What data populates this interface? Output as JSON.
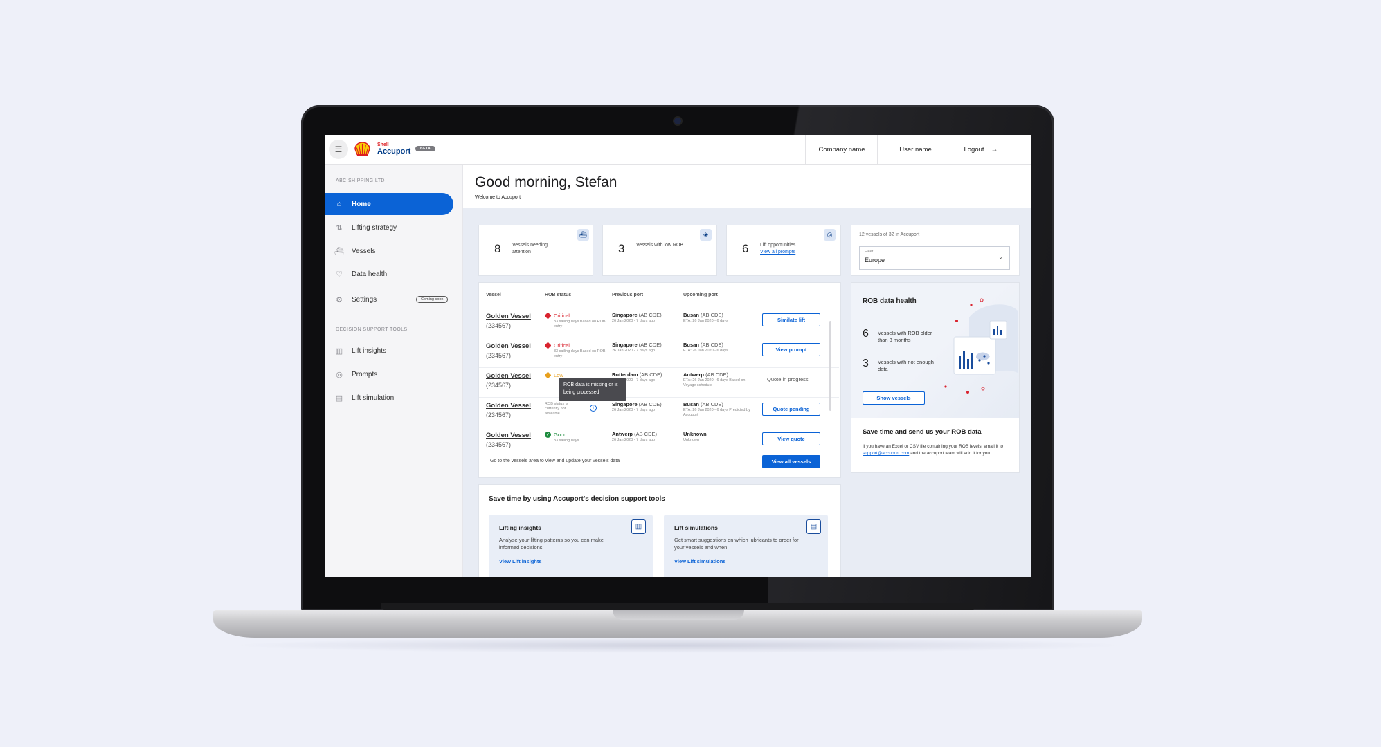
{
  "app": {
    "brand_top": "Shell",
    "brand_main": "Accuport",
    "beta": "BETA"
  },
  "topbar": {
    "company": "Company name",
    "user": "User name",
    "logout": "Logout"
  },
  "sidebar": {
    "org_label": "ABC SHIPPING LTD",
    "items": [
      {
        "label": "Home",
        "icon": "home-icon"
      },
      {
        "label": "Lifting strategy",
        "icon": "strategy-icon"
      },
      {
        "label": "Vessels",
        "icon": "ship-icon"
      },
      {
        "label": "Data health",
        "icon": "heart-icon"
      },
      {
        "label": "Settings",
        "icon": "gear-icon",
        "badge": "Coming soon"
      }
    ],
    "tools_label": "DECISION SUPPORT TOOLS",
    "tools": [
      {
        "label": "Lift insights",
        "icon": "bar-chart-icon"
      },
      {
        "label": "Prompts",
        "icon": "lightbulb-icon"
      },
      {
        "label": "Lift simulation",
        "icon": "simulation-icon"
      }
    ]
  },
  "header": {
    "greeting": "Good morning, Stefan",
    "welcome": "Welcome to Accuport"
  },
  "kpis": [
    {
      "value": "8",
      "label": "Vessels needing attention",
      "icon": "ship-icon"
    },
    {
      "value": "3",
      "label": "Vessels with low ROB",
      "icon": "alert-icon"
    },
    {
      "value": "6",
      "label": "Lift opportunities",
      "link": "View all prompts",
      "icon": "lightbulb-icon"
    }
  ],
  "fleet": {
    "title": "12 vessels of 32 in Accuport",
    "label": "Fleet",
    "value": "Europe"
  },
  "table": {
    "headers": [
      "Vessel",
      "ROB status",
      "Previous port",
      "Upcoming port"
    ],
    "rows": [
      {
        "name": "Golden Vessel",
        "id": "(234567)",
        "status": "Critical",
        "status_sub": "33 sailing days Based on ROB entry",
        "prev": "Singapore",
        "prev_code": "(AB CDE)",
        "prev_sub": "26 Jan 2020 - 7 days ago",
        "next": "Busan",
        "next_code": "(AB CDE)",
        "next_sub": "ETA: 26 Jan 2020 - 6 days",
        "action": "Similate lift"
      },
      {
        "name": "Golden Vessel",
        "id": "(234567)",
        "status": "Critical",
        "status_sub": "33 sailing days Based on ROB entry",
        "prev": "Singapore",
        "prev_code": "(AB CDE)",
        "prev_sub": "26 Jan 2020 - 7 days ago",
        "next": "Busan",
        "next_code": "(AB CDE)",
        "next_sub": "ETA: 26 Jan 2020 - 6 days",
        "action": "View prompt"
      },
      {
        "name": "Golden Vessel",
        "id": "(234567)",
        "status": "Low",
        "status_sub": "",
        "prev": "Rotterdam",
        "prev_code": "(AB CDE)",
        "prev_sub": "26 Jan 2020 - 7 days ago",
        "next": "Antwerp",
        "next_code": "(AB CDE)",
        "next_sub": "ETA: 26 Jan 2020 - 6 days Based on Voyage schedule",
        "action": "Quote in progress"
      },
      {
        "name": "Golden Vessel",
        "id": "(234567)",
        "status": "",
        "status_sub": "ROB status is currently not available",
        "prev": "Singapore",
        "prev_code": "(AB CDE)",
        "prev_sub": "26 Jan 2020 - 7 days ago",
        "next": "Busan",
        "next_code": "(AB CDE)",
        "next_sub": "ETA: 26 Jan 2020 - 6 days Predicted by Accuport",
        "action": "Quote pending"
      },
      {
        "name": "Golden Vessel",
        "id": "(234567)",
        "status": "Good",
        "status_sub": "33 sailing days",
        "prev": "Antwerp",
        "prev_code": "(AB CDE)",
        "prev_sub": "26 Jan 2020 - 7 days ago",
        "next": "Unknown",
        "next_code": "",
        "next_sub": "Unknown",
        "action": "View quote"
      }
    ],
    "tooltip": "ROB data is missing or is being processed",
    "footer": "Go to the vessels area to view and update your vessels data",
    "view_all": "View all vessels"
  },
  "rob_health": {
    "title": "ROB  data health",
    "stats": [
      {
        "value": "6",
        "label": "Vessels with ROB older than 3 months"
      },
      {
        "value": "3",
        "label": "Vessels with not enough data"
      }
    ],
    "button": "Show vessels",
    "save_title": "Save time and send us your ROB data",
    "save_pre": "If you have an Excel or CSV file containing your ROB levels, email it to",
    "save_email": "support@accuport.com",
    "save_post": "and the accuport team will add it for you"
  },
  "tools": {
    "title": "Save time by using Accuport's decision support tools",
    "cards": [
      {
        "title": "Lifting insights",
        "body": "Analyse your lifting patterns so you can make informed decisions",
        "link": "View Lift insights",
        "icon": "bar-chart-icon"
      },
      {
        "title": "Lift simulations",
        "body": "Get smart suggestions on which lubricants to order for your vessels and when",
        "link": "View Lift simulations",
        "icon": "simulation-icon"
      }
    ]
  },
  "colors": {
    "accent": "#0b63d6",
    "critical": "#d9232e",
    "low": "#e8a01d",
    "good": "#1b8a3c"
  }
}
